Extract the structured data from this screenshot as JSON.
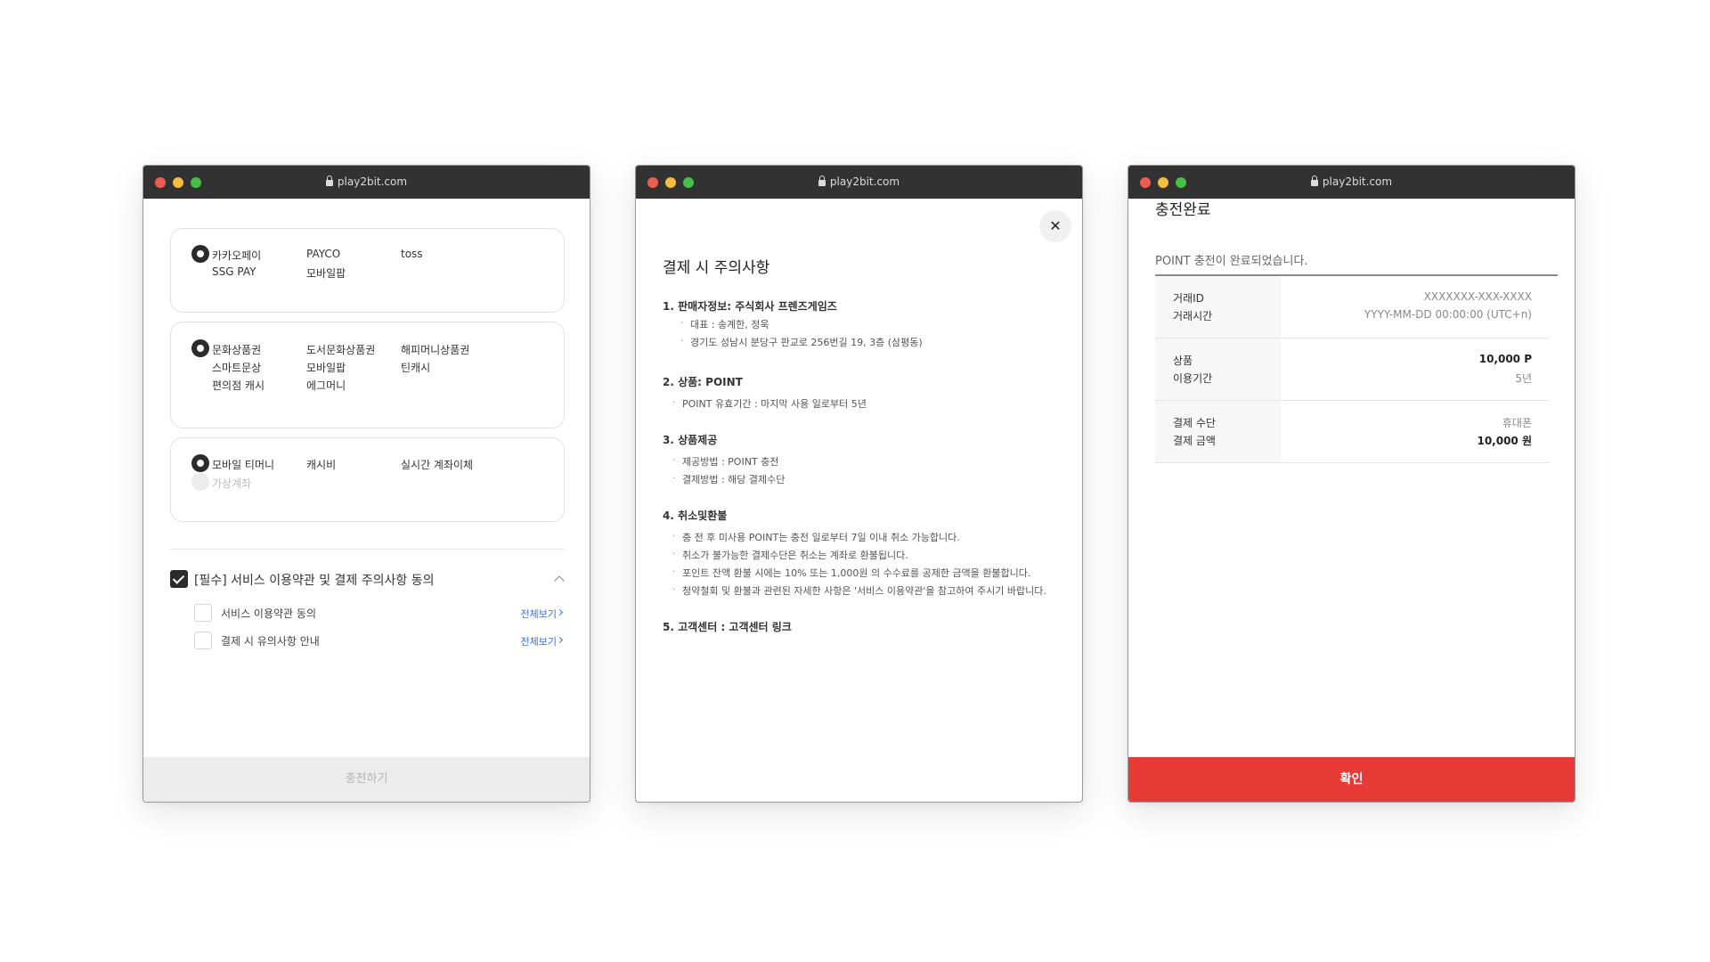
{
  "browser": {
    "url": "play2bit.com"
  },
  "payment": {
    "easy": {
      "opt1": "카카오페이",
      "opt2": "PAYCO",
      "opt3": "toss",
      "opt4": "SSG PAY",
      "opt5": "모바일팝"
    },
    "gift": {
      "opt1": "문화상품권",
      "opt2": "도서문화상품권",
      "opt3": "해피머니상품권",
      "opt4": "스마트문상",
      "opt5": "모바일팝",
      "opt6": "틴캐시",
      "opt7": "편의점 캐시",
      "opt8": "에그머니"
    },
    "phone": {
      "opt1": "모바일 티머니",
      "opt2": "캐시비",
      "opt3": "실시간 계좌이체",
      "opt4": "가상계좌"
    },
    "agree": {
      "main": "[필수] 서비스 이용약관 및 결제 주의사항 동의",
      "terms": "서비스 이용약관 동의",
      "notice": "결제 시 유의사항 안내",
      "view_all": "전체보기"
    },
    "charge_button": "충전하기"
  },
  "notice": {
    "title": "결제 시 주의사항",
    "s1_head": "1. 판매자정보: 주식회사 프렌즈게임즈",
    "s1_b1": "대표 : 송계한, 정욱",
    "s1_b2": "경기도 성남시 분당구 판교로 256번길 19, 3층 (삼평동)",
    "s2_head": "2. 상품: POINT",
    "s2_b1": "POINT 유효기간 : 마지막 사용 일로부터 5년",
    "s3_head": "3. 상품제공",
    "s3_b1": "제공방법 : POINT 충전",
    "s3_b2": "결제방법 : 해당 결제수단",
    "s4_head": "4. 취소및환불",
    "s4_b1": "충 전 후 미사용 POINT는 충전 일로부터 7일 이내 취소 가능합니다.",
    "s4_b2": "취소가 불가능한 결제수단은 취소는 계좌로 환불됩니다.",
    "s4_b3": "포인트 잔액 환불 시에는 10% 또는 1,000원 의 수수료를 공제한 금액을 환불합니다.",
    "s4_b4": "청약철회 및 환불과 관련된 자세한 사항은 '서비스 이용약관'을 참고하여 주시기 바랍니다.",
    "s5_head": "5. 고객센터 : 고객센터 링크"
  },
  "done": {
    "title": "충전완료",
    "message": "POINT 충전이 완료되었습니다.",
    "tx_id_label": "거래ID",
    "tx_time_label": "거래시간",
    "tx_id": "XXXXXXX-XXX-XXXX",
    "tx_time": "YYYY-MM-DD 00:00:00 (UTC+n)",
    "product_label": "상품",
    "period_label": "이용기간",
    "product_value": "10,000 P",
    "period_value": "5년",
    "method_label": "결제 수단",
    "amount_label": "결제 금액",
    "method_value": "휴대폰",
    "amount_value": "10,000 원",
    "confirm_button": "확인"
  }
}
